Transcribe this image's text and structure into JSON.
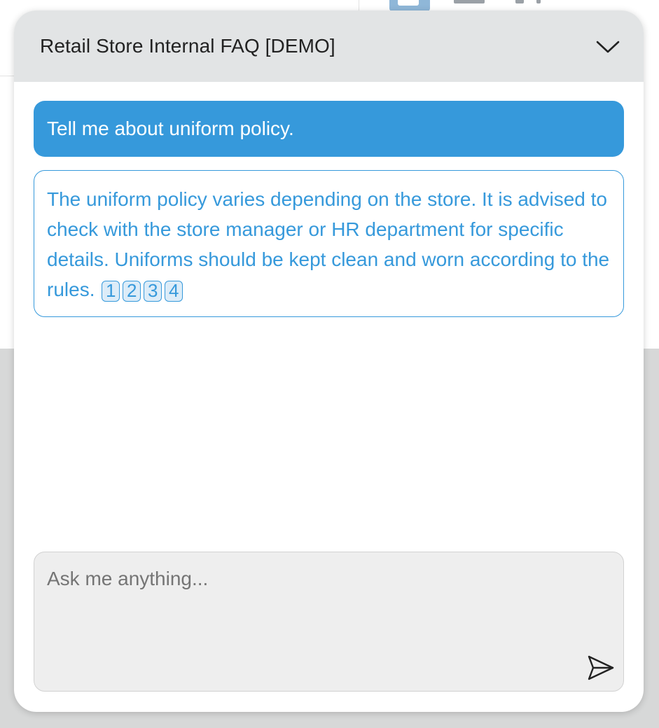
{
  "widget": {
    "title": "Retail Store Internal FAQ [DEMO]",
    "collapse_icon": "chevron-down-icon"
  },
  "conversation": {
    "user_message": "Tell me about uniform policy.",
    "bot_message": "The uniform policy varies depending on the store. It is advised to check with the store manager or HR department for specific details. Uniforms should be kept clean and worn according to the rules.",
    "citations": [
      "1",
      "2",
      "3",
      "4"
    ]
  },
  "input": {
    "placeholder": "Ask me anything...",
    "value": "",
    "send_icon": "send-icon"
  },
  "colors": {
    "accent": "#3699db",
    "header_bg": "#e2e4e5",
    "input_bg": "#eeeeee",
    "citation_bg": "#dcecf8"
  }
}
